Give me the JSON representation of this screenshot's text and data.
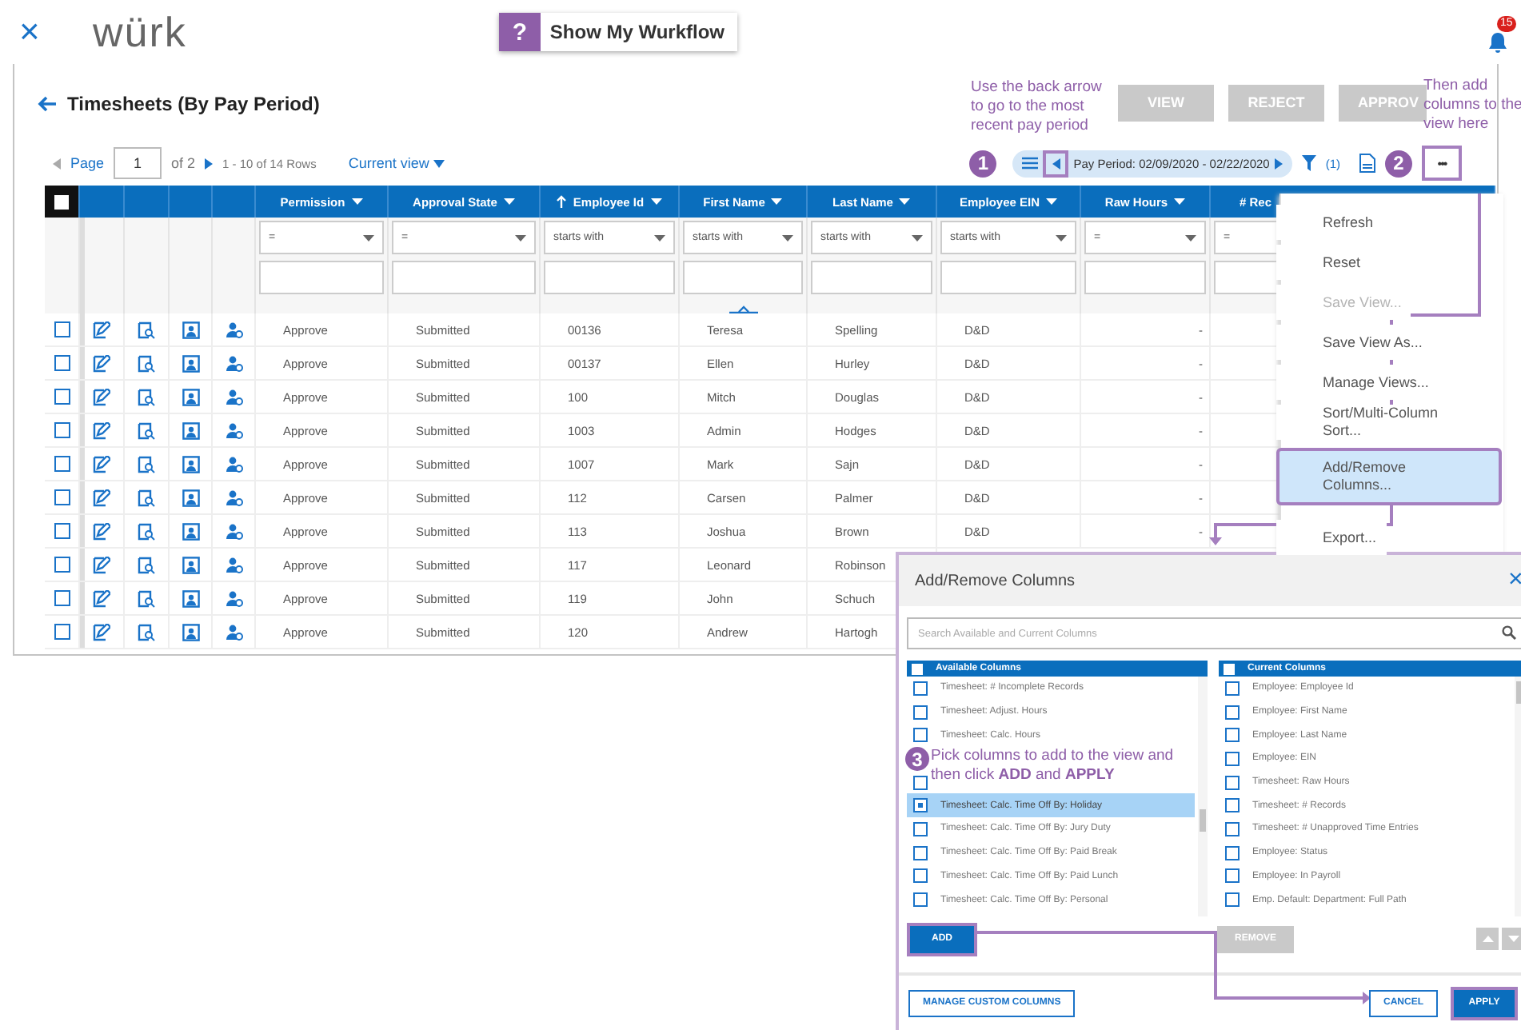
{
  "header": {
    "close": "×",
    "logo": "würk",
    "help_mark": "?",
    "help_label": "Show My Wurkflow",
    "notifications": "15"
  },
  "page": {
    "title": "Timesheets (By Pay Period)",
    "buttons": [
      {
        "label": "VIEW"
      },
      {
        "label": "REJECT"
      },
      {
        "label": "APPROV"
      }
    ]
  },
  "pager": {
    "label": "Page",
    "value": "1",
    "total": "of 2",
    "rows": "1 - 10 of 14 Rows",
    "view": "Current view"
  },
  "toolbar": {
    "period": "Pay Period: 02/09/2020 - 02/22/2020",
    "back_highlighted": true,
    "filter_count": "(1)",
    "more": "•••",
    "more_highlighted": true
  },
  "table": {
    "select_all": false,
    "columns": [
      {
        "label": "Permission",
        "sorted": false
      },
      {
        "label": "Approval State",
        "sorted": false
      },
      {
        "label": "Employee Id",
        "sorted": true
      },
      {
        "label": "First Name",
        "sorted": false
      },
      {
        "label": "Last Name",
        "sorted": false
      },
      {
        "label": "Employee EIN",
        "sorted": false
      },
      {
        "label": "Raw Hours",
        "sorted": false
      },
      {
        "label": "# Rec",
        "sorted": false
      }
    ],
    "filters": [
      "=",
      "=",
      "starts with",
      "starts with",
      "starts with",
      "starts with",
      "=",
      "="
    ],
    "rows": [
      {
        "checked": false,
        "cells": [
          "Approve",
          "Submitted",
          "00136",
          "Teresa",
          "Spelling",
          "D&D",
          "-"
        ]
      },
      {
        "checked": false,
        "cells": [
          "Approve",
          "Submitted",
          "00137",
          "Ellen",
          "Hurley",
          "D&D",
          "-"
        ]
      },
      {
        "checked": false,
        "cells": [
          "Approve",
          "Submitted",
          "100",
          "Mitch",
          "Douglas",
          "D&D",
          "-"
        ]
      },
      {
        "checked": false,
        "cells": [
          "Approve",
          "Submitted",
          "1003",
          "Admin",
          "Hodges",
          "D&D",
          "-"
        ]
      },
      {
        "checked": false,
        "cells": [
          "Approve",
          "Submitted",
          "1007",
          "Mark",
          "Sajn",
          "D&D",
          "-"
        ]
      },
      {
        "checked": false,
        "cells": [
          "Approve",
          "Submitted",
          "112",
          "Carsen",
          "Palmer",
          "D&D",
          "-"
        ]
      },
      {
        "checked": false,
        "cells": [
          "Approve",
          "Submitted",
          "113",
          "Joshua",
          "Brown",
          "D&D",
          "-"
        ]
      },
      {
        "checked": false,
        "cells": [
          "Approve",
          "Submitted",
          "117",
          "Leonard",
          "Robinson"
        ]
      },
      {
        "checked": false,
        "cells": [
          "Approve",
          "Submitted",
          "119",
          "John",
          "Schuch"
        ]
      },
      {
        "checked": false,
        "cells": [
          "Approve",
          "Submitted",
          "120",
          "Andrew",
          "Hartogh"
        ]
      }
    ]
  },
  "menu": {
    "items": [
      {
        "label": "Refresh",
        "disabled": false,
        "selected": false
      },
      {
        "label": "Reset",
        "disabled": false,
        "selected": false
      },
      {
        "label": "Save View...",
        "disabled": true,
        "selected": false
      },
      {
        "label": "Save View As...",
        "disabled": false,
        "selected": false
      },
      {
        "label": "Manage Views...",
        "disabled": false,
        "selected": false
      },
      {
        "label": "Sort/Multi-Column Sort...",
        "disabled": false,
        "selected": false
      },
      {
        "label": "Add/Remove Columns...",
        "disabled": false,
        "selected": true
      },
      {
        "label": "Export...",
        "disabled": false,
        "selected": false
      }
    ]
  },
  "dialog": {
    "title": "Add/Remove Columns",
    "close": "×",
    "search_placeholder": "Search Available and Current Columns",
    "available": {
      "title": "Available Columns",
      "items": [
        {
          "label": "Timesheet: # Incomplete Records",
          "checked": false,
          "selected": false
        },
        {
          "label": "Timesheet: Adjust. Hours",
          "checked": false,
          "selected": false
        },
        {
          "label": "Timesheet: Calc. Hours",
          "checked": false,
          "selected": false
        },
        {
          "checked": false,
          "selected": false
        },
        {
          "label": "Timesheet: Calc. Time Off By: Holiday",
          "checked": true,
          "selected": true
        },
        {
          "label": "Timesheet: Calc. Time Off By: Jury Duty",
          "checked": false,
          "selected": false
        },
        {
          "label": "Timesheet: Calc. Time Off By: Paid Break",
          "checked": false,
          "selected": false
        },
        {
          "label": "Timesheet: Calc. Time Off By: Paid Lunch",
          "checked": false,
          "selected": false
        },
        {
          "label": "Timesheet: Calc. Time Off By: Personal",
          "checked": false,
          "selected": false
        }
      ]
    },
    "current": {
      "title": "Current Columns",
      "items": [
        {
          "label": "Employee: Employee Id",
          "checked": false
        },
        {
          "label": "Employee: First Name",
          "checked": false
        },
        {
          "label": "Employee: Last Name",
          "checked": false
        },
        {
          "label": "Employee: EIN",
          "checked": false
        },
        {
          "label": "Timesheet: Raw Hours",
          "checked": false
        },
        {
          "label": "Timesheet: # Records",
          "checked": false
        },
        {
          "label": "Timesheet: # Unapproved Time Entries",
          "checked": false
        },
        {
          "label": "Employee: Status",
          "checked": false
        },
        {
          "label": "Employee: In Payroll",
          "checked": false
        },
        {
          "label": "Emp. Default: Department: Full Path",
          "checked": false
        }
      ]
    },
    "add": {
      "label": "ADD",
      "highlighted": true
    },
    "remove": {
      "label": "REMOVE",
      "disabled": true
    },
    "manage": "MANAGE CUSTOM COLUMNS",
    "cancel": "CANCEL",
    "apply": {
      "label": "APPLY",
      "highlighted": true
    }
  },
  "annotations": [
    {
      "marker": "1",
      "text": "Use the back arrow to go to the most recent pay period"
    },
    {
      "marker": "2",
      "text": "Then add columns to the view here"
    },
    {
      "marker": "3",
      "text": "Pick columns to add to the view and then click **ADD** and **APPLY**"
    }
  ]
}
